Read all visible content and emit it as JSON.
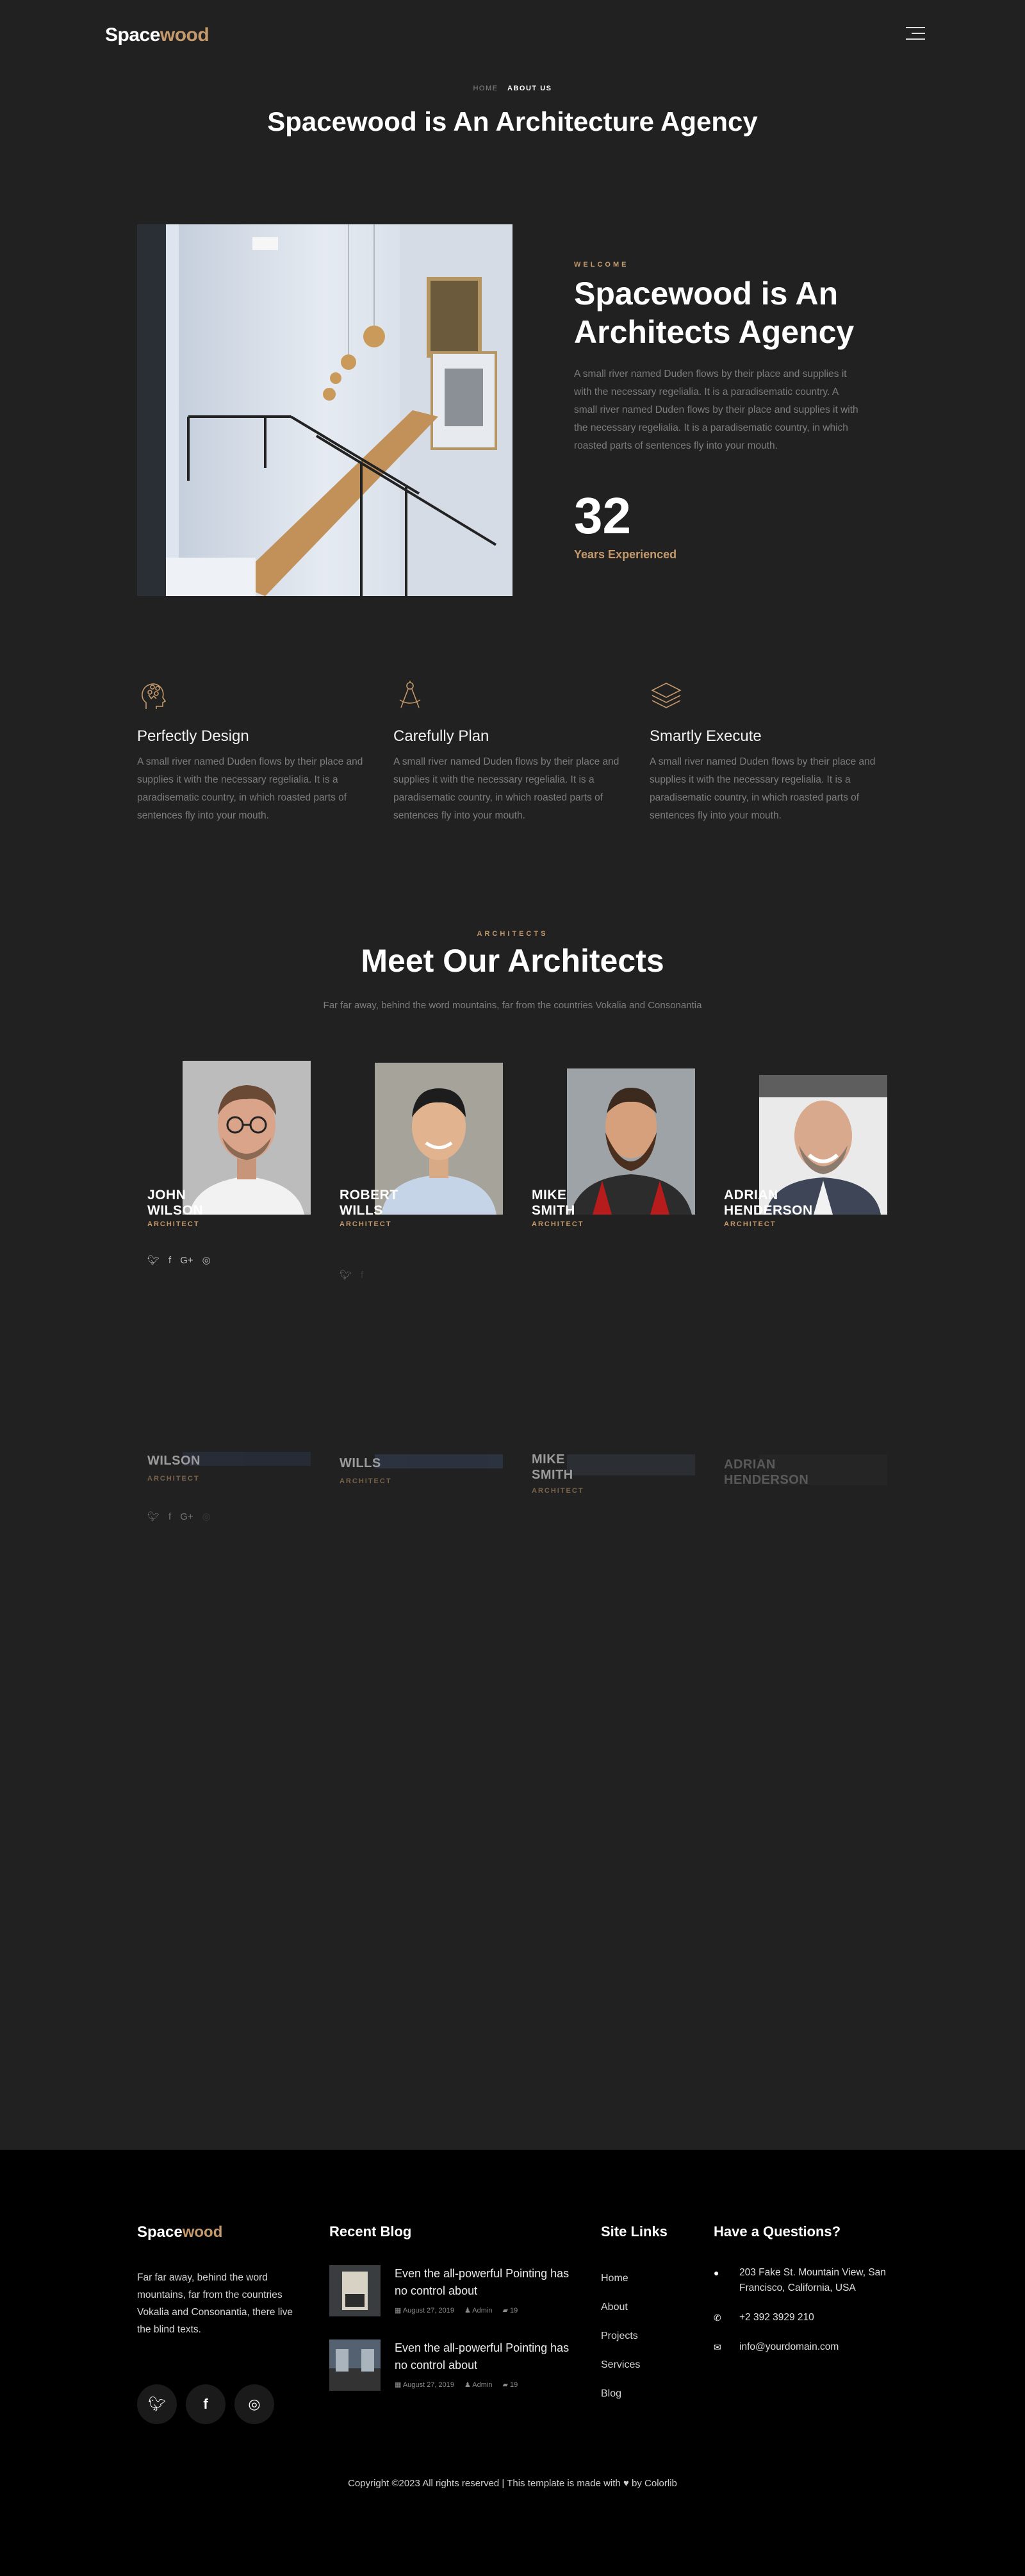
{
  "header": {
    "logo_main": "Space",
    "logo_accent": "wood",
    "menu_icon": "hamburger-menu-icon"
  },
  "hero": {
    "breadcrumbs": {
      "home": "HOME",
      "current": "ABOUT US"
    },
    "title": "Spacewood is An Architecture Agency"
  },
  "about": {
    "eyebrow": "WELCOME",
    "title": "Spacewood is An Architects Agency",
    "text": "A small river named Duden flows by their place and supplies it with the necessary regelialia. It is a paradisematic country. A small river named Duden flows by their place and supplies it with the necessary regelialia. It is a paradisematic country, in which roasted parts of sentences fly into your mouth.",
    "number": "32",
    "number_label": "Years Experienced"
  },
  "features": [
    {
      "icon": "lightbulb-head-icon",
      "title": "Perfectly Design",
      "text": "A small river named Duden flows by their place and supplies it with the necessary regelialia. It is a paradisematic country, in which roasted parts of sentences fly into your mouth."
    },
    {
      "icon": "compass-drafting-icon",
      "title": "Carefully Plan",
      "text": "A small river named Duden flows by their place and supplies it with the necessary regelialia. It is a paradisematic country, in which roasted parts of sentences fly into your mouth."
    },
    {
      "icon": "layers-icon",
      "title": "Smartly Execute",
      "text": "A small river named Duden flows by their place and supplies it with the necessary regelialia. It is a paradisematic country, in which roasted parts of sentences fly into your mouth."
    }
  ],
  "architects_section": {
    "eyebrow": "ARCHITECTS",
    "title": "Meet Our Architects",
    "subtitle": "Far far away, behind the word mountains, far from the countries Vokalia and Consonantia"
  },
  "architects": [
    {
      "first": "JOHN",
      "last": "WILSON",
      "role": "ARCHITECT"
    },
    {
      "first": "ROBERT",
      "last": "WILLS",
      "role": "ARCHITECT"
    },
    {
      "first": "MIKE",
      "last": "SMITH",
      "role": "ARCHITECT"
    },
    {
      "first": "ADRIAN",
      "last": "HENDERSON",
      "role": "ARCHITECT"
    }
  ],
  "social_icons": [
    "twitter-icon",
    "facebook-icon",
    "google-plus-icon",
    "instagram-icon"
  ],
  "footer": {
    "logo_main": "Space",
    "logo_accent": "wood",
    "about_text": "Far far away, behind the word mountains, far from the countries Vokalia and Consonantia, there live the blind texts.",
    "recent_blog_heading": "Recent Blog",
    "blog": [
      {
        "title": "Even the all-powerful Pointing has no control about",
        "date": "August 27, 2019",
        "author": "Admin",
        "comments": "19"
      },
      {
        "title": "Even the all-powerful Pointing has no control about",
        "date": "August 27, 2019",
        "author": "Admin",
        "comments": "19"
      }
    ],
    "site_links_heading": "Site Links",
    "links": [
      "Home",
      "About",
      "Projects",
      "Services",
      "Blog"
    ],
    "contact_heading": "Have a Questions?",
    "address": "203 Fake St. Mountain View, San Francisco, California, USA",
    "phone": "+2 392 3929 210",
    "email": "info@yourdomain.com",
    "copyright_prefix": "Copyright ©2023 All rights reserved | This template is made with",
    "copyright_suffix": "by Colorlib"
  },
  "colors": {
    "accent": "#c49a6c",
    "background": "#212121",
    "footer": "#000000"
  }
}
